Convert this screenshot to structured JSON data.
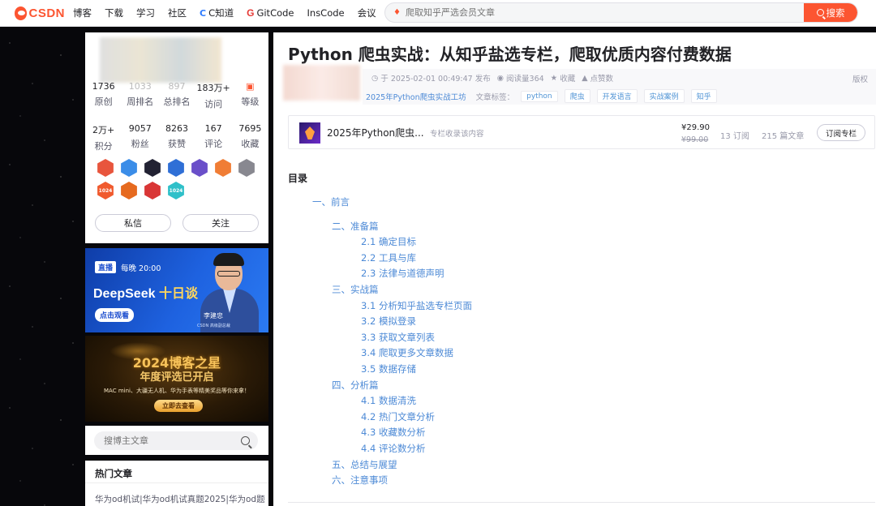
{
  "header": {
    "logo_text": "CSDN",
    "nav": [
      "博客",
      "下载",
      "学习",
      "社区",
      "C知道",
      "GitCode",
      "InsCode",
      "会议"
    ],
    "search_placeholder": "爬取知乎严选会员文章",
    "search_button": "搜索"
  },
  "profile": {
    "stats_row1": [
      {
        "value": "1736",
        "label": "原创"
      },
      {
        "value": "1033",
        "label": "周排名"
      },
      {
        "value": "897",
        "label": "总排名"
      },
      {
        "value": "183万+",
        "label": "访问"
      },
      {
        "value": "",
        "label": "等级"
      }
    ],
    "stats_row2": [
      {
        "value": "2万+",
        "label": "积分"
      },
      {
        "value": "9057",
        "label": "粉丝"
      },
      {
        "value": "8263",
        "label": "获赞"
      },
      {
        "value": "167",
        "label": "评论"
      },
      {
        "value": "7695",
        "label": "收藏"
      }
    ],
    "badge_colors": [
      "#e8553d",
      "#3b8de8",
      "#222233",
      "#2f6fd6",
      "#6a4fc9",
      "#f07d35",
      "#888890",
      "#f05a2e",
      "#e66a1f",
      "#d93636",
      "#2fc0c9"
    ],
    "badge_texts": {
      "badge7": "1024",
      "badge10": "1024"
    },
    "message_button": "私信",
    "follow_button": "关注"
  },
  "ad_live": {
    "live_tag": "直播",
    "time": "每晚 20:00",
    "title_a": "DeepSeek",
    "title_b": "十日谈",
    "cta": "点击观看",
    "speaker": "李建忠",
    "speaker_sub": "CSDN 高级副总裁"
  },
  "ad_award": {
    "title": "2024博客之星",
    "subtitle": "年度评选已开启",
    "desc": "MAC mini、大疆无人机、华为手表等精美奖品等你来拿！",
    "cta": "立即去查看"
  },
  "blog_search": {
    "placeholder": "搜博主文章"
  },
  "hot_articles": {
    "title": "热门文章",
    "items": [
      "华为od机试|华为od机试真题2025|华为od题"
    ]
  },
  "article": {
    "title": "Python 爬虫实战：从知乎盐选专栏，爬取优质内容付费数据",
    "published": "于 2025-02-01 00:49:47 发布",
    "reads": "阅读量364",
    "favorite": "收藏",
    "likes": "点赞数",
    "copyright": "版权",
    "column_link": "2025年Python爬虫实战工坊",
    "tags_label": "文章标签：",
    "tags": [
      "python",
      "爬虫",
      "开发语言",
      "实战案例",
      "知乎"
    ]
  },
  "column": {
    "name": "2025年Python爬虫...",
    "note": "专栏收录该内容",
    "price": "¥29.90",
    "original_price": "¥99.00",
    "subscribers": "13 订阅",
    "articles": "215 篇文章",
    "subscribe_button": "订阅专栏"
  },
  "toc": {
    "heading": "目录",
    "items": [
      {
        "level": 1,
        "text": "一、前言"
      },
      {
        "level": 2,
        "text": "二、准备篇"
      },
      {
        "level": 3,
        "text": "2.1 确定目标"
      },
      {
        "level": 3,
        "text": "2.2 工具与库"
      },
      {
        "level": 3,
        "text": "2.3 法律与道德声明"
      },
      {
        "level": 2,
        "text": "三、实战篇"
      },
      {
        "level": 3,
        "text": "3.1 分析知乎盐选专栏页面"
      },
      {
        "level": 3,
        "text": "3.2 模拟登录"
      },
      {
        "level": 3,
        "text": "3.3 获取文章列表"
      },
      {
        "level": 3,
        "text": "3.4 爬取更多文章数据"
      },
      {
        "level": 3,
        "text": "3.5 数据存储"
      },
      {
        "level": 2,
        "text": "四、分析篇"
      },
      {
        "level": 3,
        "text": "4.1 数据清洗"
      },
      {
        "level": 3,
        "text": "4.2 热门文章分析"
      },
      {
        "level": 3,
        "text": "4.3 收藏数分析"
      },
      {
        "level": 3,
        "text": "4.4 评论数分析"
      },
      {
        "level": 2,
        "text": "五、总结与展望"
      },
      {
        "level": 2,
        "text": "六、注意事项"
      }
    ]
  }
}
